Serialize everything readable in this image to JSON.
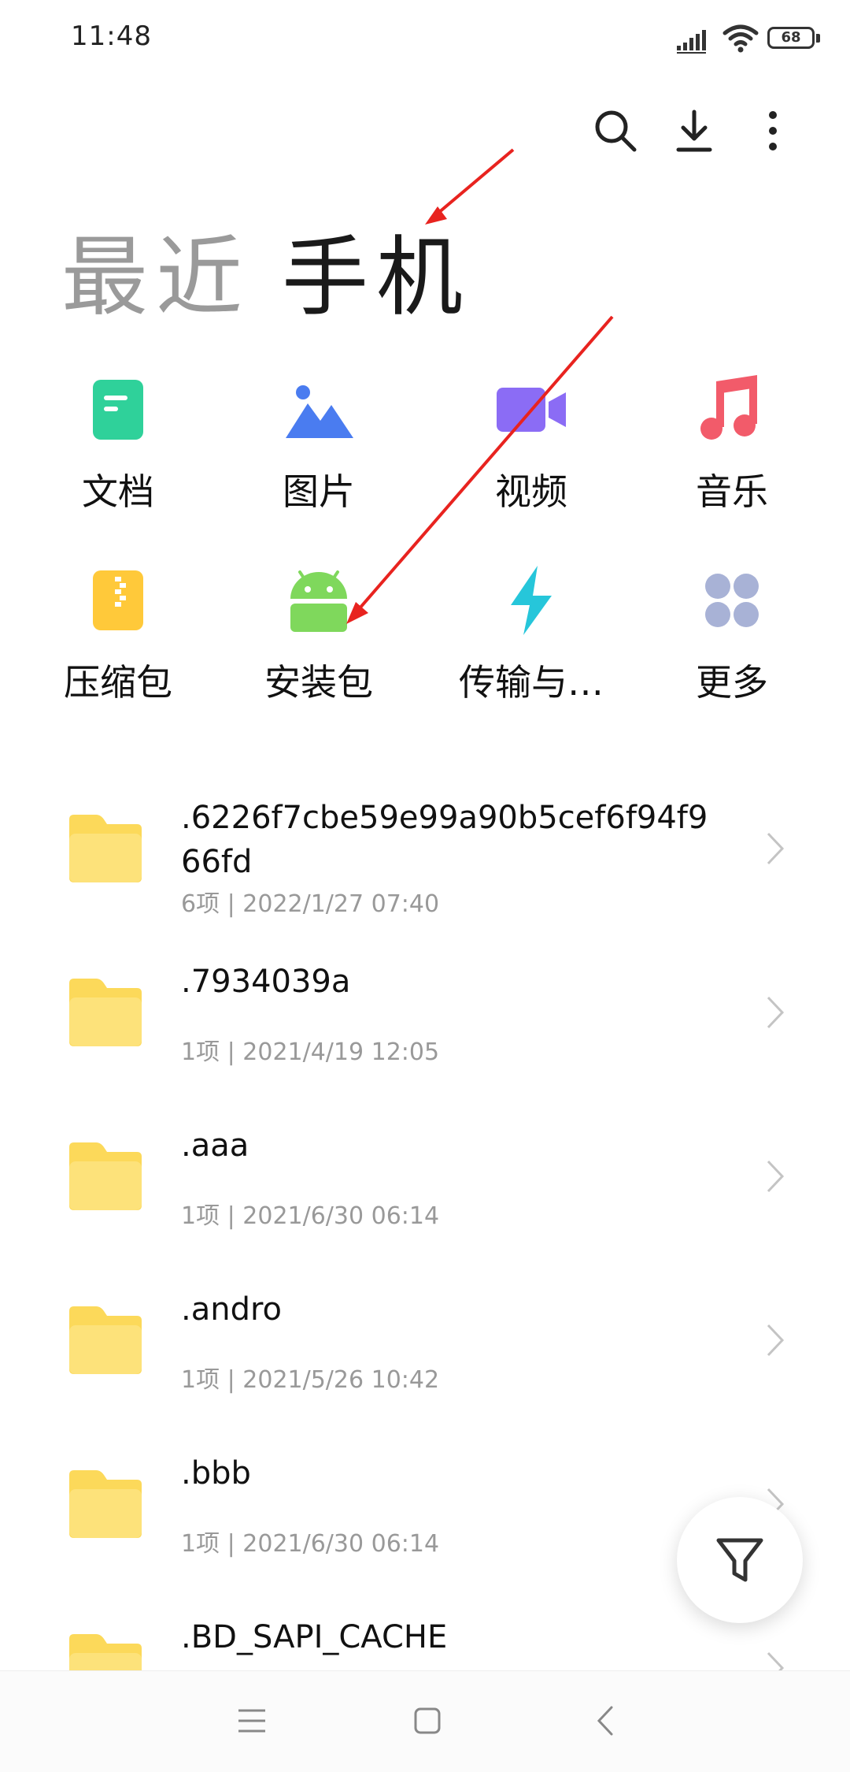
{
  "status_bar": {
    "time": "11:48",
    "battery": "68"
  },
  "toolbar": {
    "icons": [
      "search-icon",
      "download-icon",
      "more-vertical-icon"
    ]
  },
  "tabs": {
    "recent": "最近",
    "phone": "手机"
  },
  "categories": [
    {
      "label": "文档",
      "icon": "document-icon",
      "color": "#2fd19a"
    },
    {
      "label": "图片",
      "icon": "image-icon",
      "color": "#4a7cf0"
    },
    {
      "label": "视频",
      "icon": "video-icon",
      "color": "#8b6cf5"
    },
    {
      "label": "音乐",
      "icon": "music-icon",
      "color": "#f25b6a"
    },
    {
      "label": "压缩包",
      "icon": "archive-icon",
      "color": "#ffc93a"
    },
    {
      "label": "安装包",
      "icon": "android-icon",
      "color": "#7fd85c"
    },
    {
      "label": "传输与…",
      "icon": "transfer-icon",
      "color": "#26c6da"
    },
    {
      "label": "更多",
      "icon": "more-grid-icon",
      "color": "#a8b2d6"
    }
  ],
  "folders": [
    {
      "name": ".6226f7cbe59e99a90b5cef6f94f966fd",
      "meta": "6项 | 2022/1/27 07:40"
    },
    {
      "name": ".7934039a",
      "meta": "1项 | 2021/4/19 12:05"
    },
    {
      "name": ".aaa",
      "meta": "1项 | 2021/6/30 06:14"
    },
    {
      "name": ".andro",
      "meta": "1项 | 2021/5/26 10:42"
    },
    {
      "name": ".bbb",
      "meta": "1项 | 2021/6/30 06:14"
    },
    {
      "name": ".BD_SAPI_CACHE",
      "meta": ""
    }
  ],
  "fab": {
    "icon": "filter-icon"
  },
  "nav_bar": {
    "icons": [
      "menu-icon",
      "home-icon",
      "back-icon"
    ]
  },
  "colors": {
    "folder": "#fcd95a",
    "annotation": "#e8231f"
  }
}
